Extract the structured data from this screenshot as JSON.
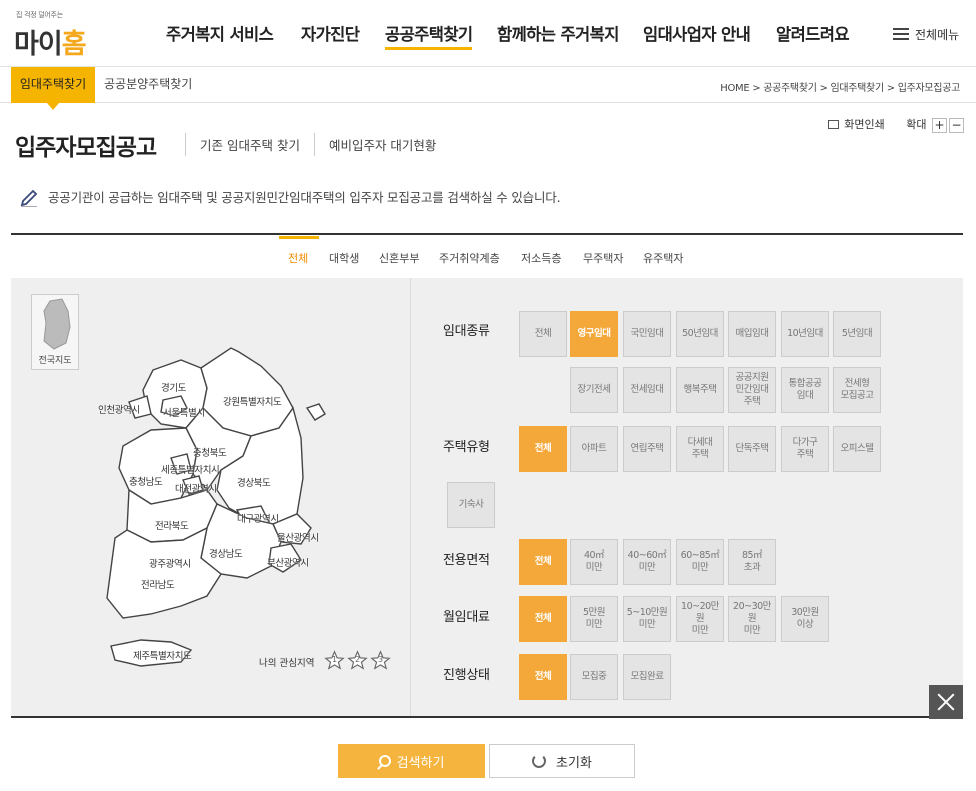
{
  "logo": {
    "tagline": "집 걱정 덜어주는",
    "name_a": "마이",
    "name_b": "홈"
  },
  "gnb": [
    {
      "label": "주거복지 서비스"
    },
    {
      "label": "자가진단"
    },
    {
      "label": "공공주택찾기"
    },
    {
      "label": "함께하는 주거복지"
    },
    {
      "label": "임대사업자 안내"
    },
    {
      "label": "알려드려요"
    }
  ],
  "all_menu": "전체메뉴",
  "subnav": {
    "active": "임대주택찾기",
    "other": "공공분양주택찾기"
  },
  "breadcrumb": "HOME > 공공주택찾기 > 임대주택찾기 > 입주자모집공고",
  "title": "입주자모집공고",
  "title_links": [
    "기존 임대주택 찾기",
    "예비입주자 대기현황"
  ],
  "tools": {
    "print": "화면인쇄",
    "zoom": "확대",
    "plus": "+",
    "minus": "−"
  },
  "description": "공공기관이 공급하는 임대주택 및 공공지원민간임대주택의 입주자 모집공고를 검색하실 수 있습니다.",
  "categories": [
    "전체",
    "대학생",
    "신혼부부",
    "주거취약계층",
    "저소득층",
    "무주택자",
    "유주택자"
  ],
  "map": {
    "nationwide": "전국지도",
    "regions": [
      "경기도",
      "인천광역시",
      "서울특별시",
      "강원특별자치도",
      "충청북도",
      "세종특별자치시",
      "충청남도",
      "대전광역시",
      "경상북도",
      "대구광역시",
      "전라북도",
      "울산광역시",
      "경상남도",
      "부산광역시",
      "광주광역시",
      "전라남도",
      "제주특별자치도"
    ],
    "favorite_label": "나의 관심지역",
    "stars": [
      "1",
      "2",
      "3"
    ]
  },
  "filters": {
    "rental_type": {
      "label": "임대종류",
      "options": [
        "전체",
        "영구임대",
        "국민임대",
        "50년임대",
        "매입임대",
        "10년임대",
        "5년임대",
        "장기전세",
        "전세임대",
        "행복주택",
        "공공지원\n민간임대\n주택",
        "통합공공\n임대",
        "전세형\n모집공고"
      ],
      "selected": "영구임대"
    },
    "house_type": {
      "label": "주택유형",
      "options": [
        "전체",
        "아파트",
        "연립주택",
        "다세대\n주택",
        "단독주택",
        "다가구\n주택",
        "오피스텔",
        "기숙사"
      ],
      "selected": "전체"
    },
    "area": {
      "label": "전용면적",
      "options": [
        "전체",
        "40㎡\n미만",
        "40~60㎡\n미만",
        "60~85㎡\n미만",
        "85㎡\n초과"
      ],
      "selected": "전체"
    },
    "rent": {
      "label": "월임대료",
      "options": [
        "전체",
        "5만원\n미만",
        "5~10만원\n미만",
        "10~20만원\n미만",
        "20~30만원\n미만",
        "30만원\n이상"
      ],
      "selected": "전체"
    },
    "status": {
      "label": "진행상태",
      "options": [
        "전체",
        "모집중",
        "모집완료"
      ],
      "selected": "전체"
    }
  },
  "actions": {
    "search": "검색하기",
    "reset": "초기화"
  },
  "colors": {
    "accent": "#f4b400",
    "selected": "#f4a83a"
  }
}
